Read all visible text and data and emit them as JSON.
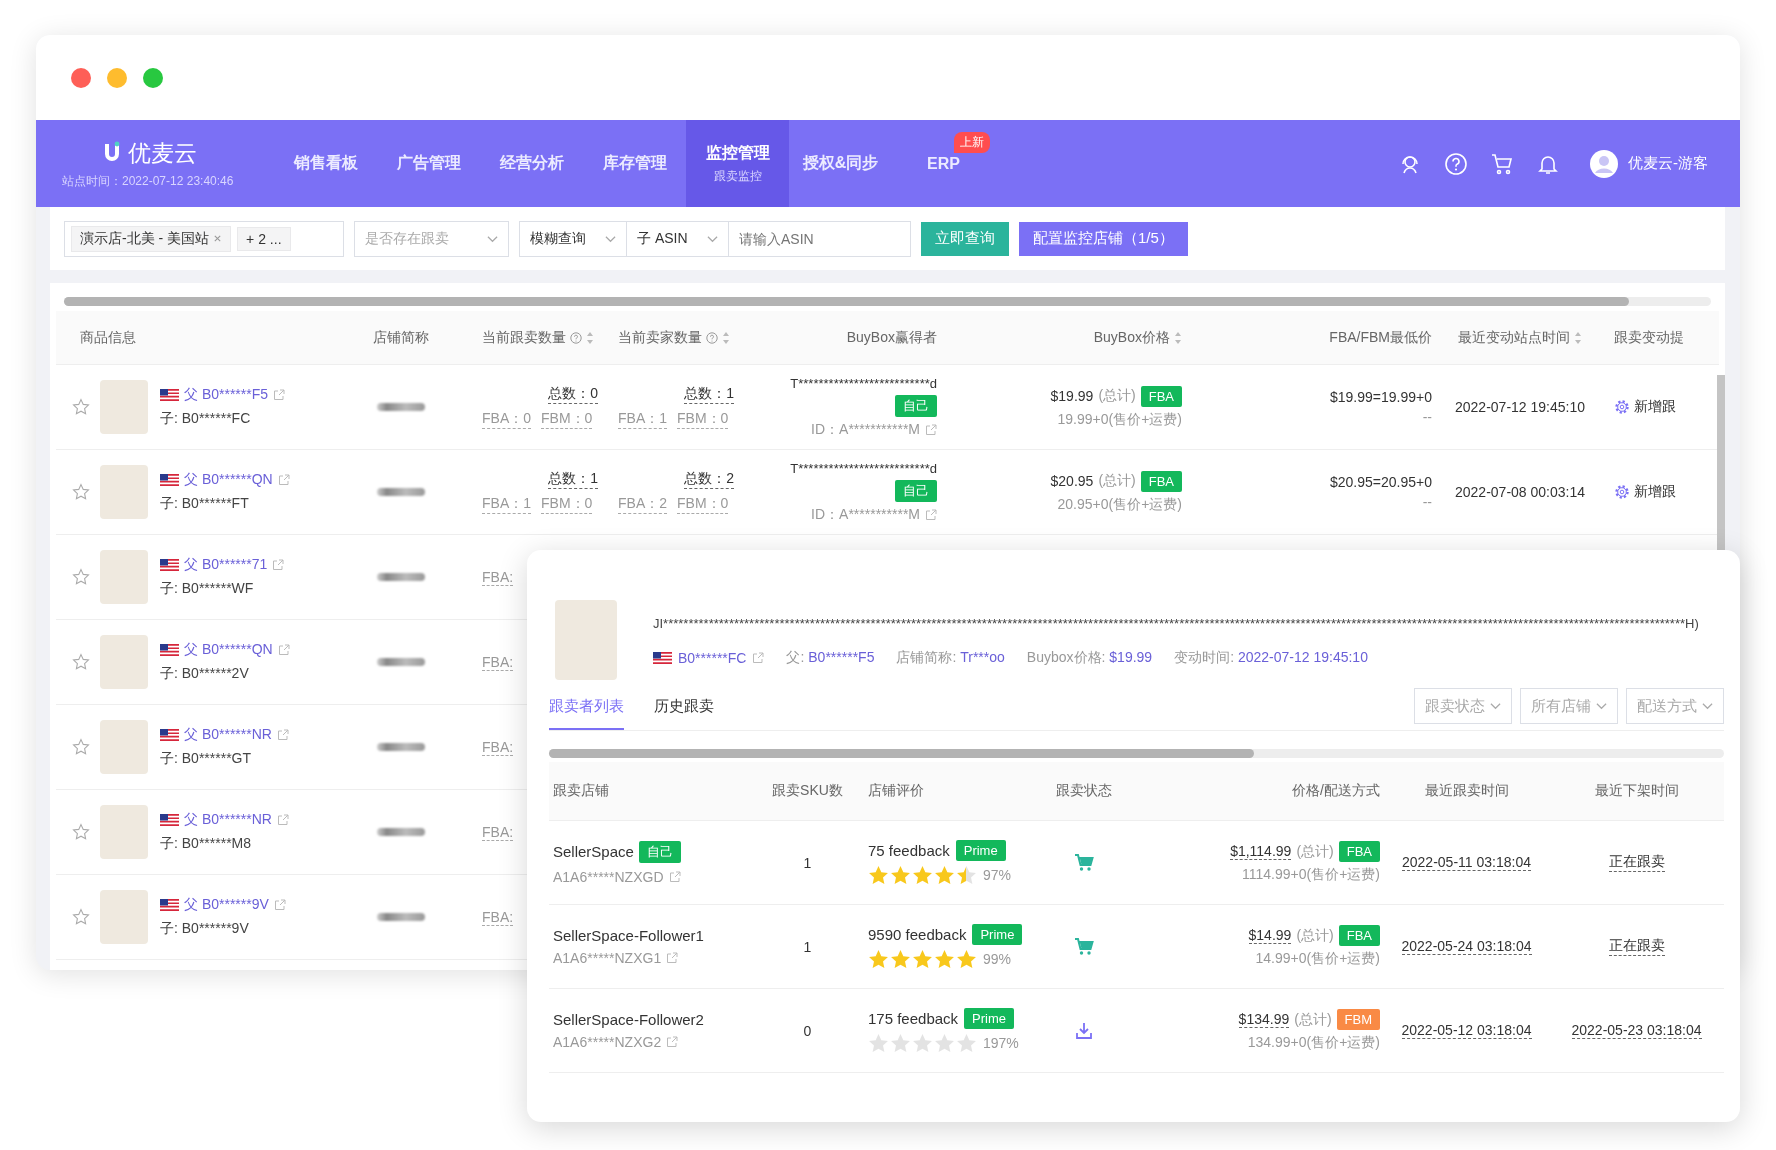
{
  "window": {
    "controls": [
      {
        "color": "#fe5f57"
      },
      {
        "color": "#febc2e"
      },
      {
        "color": "#28c840"
      }
    ]
  },
  "nav": {
    "brand": "优麦云",
    "site_time": "站点时间：2022-07-12 23:40:46",
    "items": [
      {
        "label": "销售看板",
        "selected": false
      },
      {
        "label": "广告管理",
        "selected": false
      },
      {
        "label": "经营分析",
        "selected": false
      },
      {
        "label": "库存管理",
        "selected": false
      },
      {
        "label": "监控管理",
        "sub": "跟卖监控",
        "selected": true
      },
      {
        "label": "授权&同步",
        "selected": false
      },
      {
        "label": "ERP",
        "badge": "上新",
        "selected": false
      }
    ],
    "user": "优麦云-游客"
  },
  "filters": {
    "store_tag": "演示店-北美 - 美国站",
    "more_tag": "+ 2 ...",
    "follow_select": {
      "placeholder": "是否存在跟卖"
    },
    "match_select": "模糊查询",
    "asin_type_select": "子 ASIN",
    "asin_input": {
      "placeholder": "请输入ASIN"
    },
    "buttons": [
      "立即查询",
      "配置监控店铺（1/5）"
    ]
  },
  "table": {
    "columns": [
      {
        "label": "商品信息",
        "help": false,
        "sortable": false
      },
      {
        "label": "店铺简称",
        "help": false,
        "sortable": false
      },
      {
        "label": "当前跟卖数量",
        "help": true,
        "sortable": true
      },
      {
        "label": "当前卖家数量",
        "help": true,
        "sortable": true
      },
      {
        "label": "BuyBox赢得者",
        "help": false,
        "sortable": false
      },
      {
        "label": "BuyBox价格",
        "help": false,
        "sortable": true
      },
      {
        "label": "FBA/FBM最低价",
        "help": false,
        "sortable": false
      },
      {
        "label": "最近变动站点时间",
        "help": false,
        "sortable": true
      },
      {
        "label": "跟卖变动提",
        "help": false,
        "sortable": false
      }
    ],
    "rows": [
      {
        "favorite": false,
        "parent_asin": "父 B0******F5",
        "child_asin": "子: B0******FC",
        "follow": {
          "total": "总数：0",
          "fba": "FBA：0",
          "fbm": "FBM：0"
        },
        "sellers": {
          "total": "总数：1",
          "fba": "FBA：1",
          "fbm": "FBM：0"
        },
        "buybox_winner": {
          "name": "T**************************d",
          "badge": "自己",
          "id": "ID：A***********M"
        },
        "buybox_price": {
          "price": "$19.99",
          "note": "(总计)",
          "ship": {
            "label": "FBA",
            "color": "#13b85b"
          },
          "detail": "19.99+0(售价+运费)"
        },
        "lowest": {
          "price": "$19.99=19.99+0",
          "sub": "--"
        },
        "changed_at": "2022-07-12 19:45:10",
        "action": "新增跟"
      },
      {
        "favorite": false,
        "parent_asin": "父 B0******QN",
        "child_asin": "子: B0******FT",
        "follow": {
          "total": "总数：1",
          "fba": "FBA：1",
          "fbm": "FBM：0"
        },
        "sellers": {
          "total": "总数：2",
          "fba": "FBA：2",
          "fbm": "FBM：0"
        },
        "buybox_winner": {
          "name": "T**************************d",
          "badge": "自己",
          "id": "ID：A***********M"
        },
        "buybox_price": {
          "price": "$20.95",
          "note": "(总计)",
          "ship": {
            "label": "FBA",
            "color": "#13b85b"
          },
          "detail": "20.95+0(售价+运费)"
        },
        "lowest": {
          "price": "$20.95=20.95+0",
          "sub": "--"
        },
        "changed_at": "2022-07-08 00:03:14",
        "action": "新增跟"
      },
      {
        "favorite": false,
        "parent_asin": "父 B0******71",
        "child_asin": "子: B0******WF",
        "follow": {
          "fba": "FBA:"
        }
      },
      {
        "favorite": false,
        "parent_asin": "父 B0******QN",
        "child_asin": "子: B0******2V",
        "follow": {
          "fba": "FBA:"
        }
      },
      {
        "favorite": false,
        "parent_asin": "父 B0******NR",
        "child_asin": "子: B0******GT",
        "follow": {
          "fba": "FBA:"
        }
      },
      {
        "favorite": false,
        "parent_asin": "父 B0******NR",
        "child_asin": "子: B0******M8",
        "follow": {
          "fba": "FBA:"
        }
      },
      {
        "favorite": false,
        "parent_asin": "父 B0******9V",
        "child_asin": "子: B0******9V",
        "follow": {
          "fba": "FBA:"
        }
      }
    ]
  },
  "popup": {
    "title": "JI**********************************************************************************************************************************************************************************************************H)",
    "asin": "B0******FC",
    "meta": [
      {
        "label": "父:",
        "value": "B0******F5"
      },
      {
        "label": "店铺简称:",
        "value": "Tr***oo"
      },
      {
        "label": "Buybox价格:",
        "value": "$19.99"
      },
      {
        "label": "变动时间:",
        "value": "2022-07-12 19:45:10"
      }
    ],
    "tabs": [
      {
        "label": "跟卖者列表",
        "selected": true
      },
      {
        "label": "历史跟卖",
        "selected": false
      }
    ],
    "filters": [
      "跟卖状态",
      "所有店铺",
      "配送方式"
    ],
    "table": {
      "columns": [
        "跟卖店铺",
        "跟卖SKU数",
        "店铺评价",
        "跟卖状态",
        "价格/配送方式",
        "最近跟卖时间",
        "最近下架时间"
      ],
      "rows": [
        {
          "store": "SellerSpace",
          "badge": "自己",
          "seller_id": "A1A6*****NZXGD",
          "sku_count": "1",
          "feedback": "75 feedback",
          "prime": "Prime",
          "stars": 4.5,
          "rating": "97%",
          "kind": "cart",
          "price": "$1,114.99",
          "note": "(总计)",
          "ship": {
            "label": "FBA",
            "color": "#13b85b"
          },
          "detail": "1114.99+0(售价+运费)",
          "last_follow": "2022-05-11 03:18:04",
          "last_off": "正在跟卖"
        },
        {
          "store": "SellerSpace-Follower1",
          "seller_id": "A1A6*****NZXG1",
          "sku_count": "1",
          "feedback": "9590 feedback",
          "prime": "Prime",
          "stars": 5,
          "rating": "99%",
          "kind": "cart",
          "price": "$14.99",
          "note": "(总计)",
          "ship": {
            "label": "FBA",
            "color": "#13b85b"
          },
          "detail": "14.99+0(售价+运费)",
          "last_follow": "2022-05-24 03:18:04",
          "last_off": "正在跟卖"
        },
        {
          "store": "SellerSpace-Follower2",
          "seller_id": "A1A6*****NZXG2",
          "sku_count": "0",
          "feedback": "175 feedback",
          "prime": "Prime",
          "stars": 0,
          "rating": "197%",
          "kind": "download",
          "price": "$134.99",
          "note": "(总计)",
          "ship": {
            "label": "FBM",
            "color": "#f98a45"
          },
          "detail": "134.99+0(售价+运费)",
          "last_follow": "2022-05-12 03:18:04",
          "last_off": "2022-05-23 03:18:04"
        }
      ]
    }
  }
}
